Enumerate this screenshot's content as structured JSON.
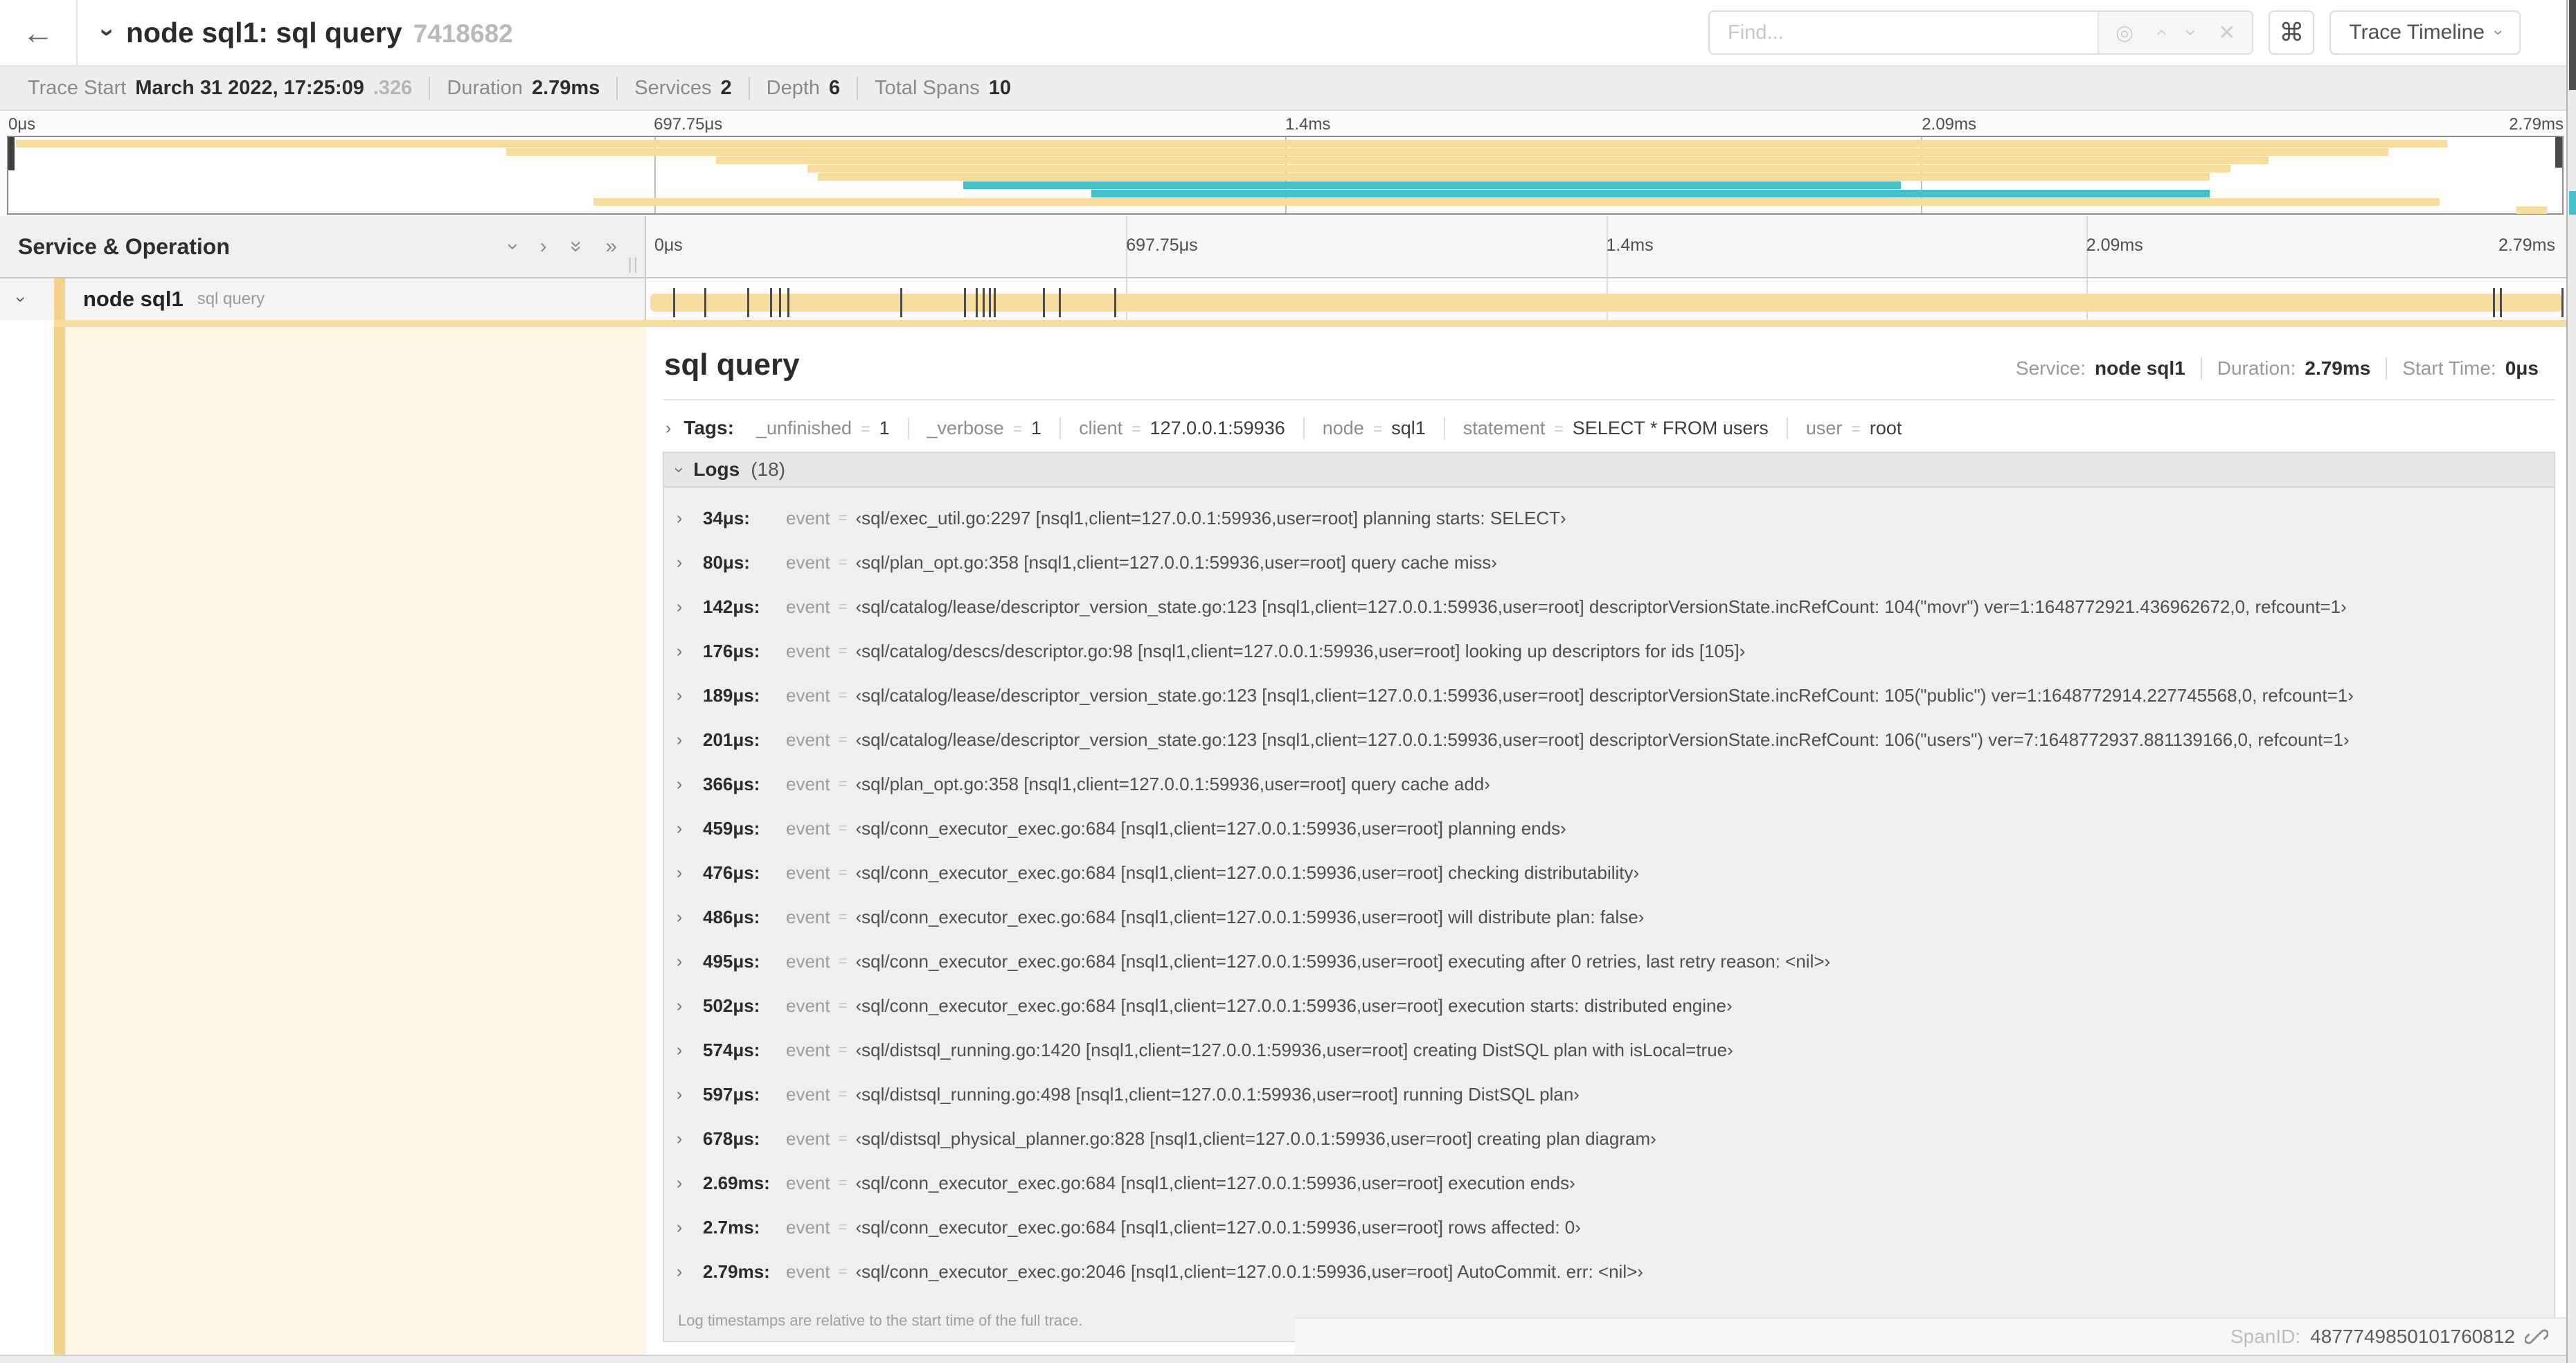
{
  "colors": {
    "tan": "#F7DCA0",
    "stripe": "#F5D28C",
    "cream": "#FDF6E7",
    "teal": "#45C2C9"
  },
  "header": {
    "back_icon": "←",
    "collapse_icon": "›",
    "title": "node sql1: sql query",
    "trace_id": "7418682",
    "find_placeholder": "Find...",
    "find_icons": {
      "locate": "◎",
      "prev": "›",
      "next": "›",
      "clear": "✕"
    },
    "shortcut_label": "⌘",
    "view_button_label": "Trace Timeline",
    "view_button_chev": "›"
  },
  "trace_info": {
    "items": [
      {
        "label": "Trace Start",
        "value": "March 31 2022, 17:25:09",
        "suffix": ".326"
      },
      {
        "label": "Duration",
        "value": "2.79ms",
        "suffix": ""
      },
      {
        "label": "Services",
        "value": "2",
        "suffix": ""
      },
      {
        "label": "Depth",
        "value": "6",
        "suffix": ""
      },
      {
        "label": "Total Spans",
        "value": "10",
        "suffix": ""
      }
    ]
  },
  "timeline": {
    "ruler_labels": [
      "0μs",
      "697.75μs",
      "1.4ms",
      "2.09ms",
      "2.79ms"
    ],
    "total_us": 2790,
    "tick_times_us": [
      34,
      80,
      142,
      176,
      189,
      201,
      366,
      459,
      476,
      486,
      495,
      502,
      574,
      597,
      678,
      2690,
      2700,
      2790
    ]
  },
  "minimap": {
    "bars": [
      {
        "color": "tan",
        "x": 0.003,
        "w": 0.952,
        "row": 0
      },
      {
        "color": "tan",
        "x": 0.195,
        "w": 0.737,
        "row": 1
      },
      {
        "color": "tan",
        "x": 0.277,
        "w": 0.608,
        "row": 2
      },
      {
        "color": "tan",
        "x": 0.313,
        "w": 0.557,
        "row": 3
      },
      {
        "color": "tan",
        "x": 0.317,
        "w": 0.545,
        "row": 4
      },
      {
        "color": "teal",
        "x": 0.374,
        "w": 0.367,
        "row": 5
      },
      {
        "color": "teal",
        "x": 0.424,
        "w": 0.438,
        "row": 6
      },
      {
        "color": "tan",
        "x": 0.229,
        "w": 0.723,
        "row": 7
      },
      {
        "color": "tan",
        "x": 0.982,
        "w": 0.012,
        "row": 8
      }
    ]
  },
  "span_list": {
    "header": "Service & Operation",
    "icons": {
      "collapse_one": "›",
      "expand_one": "›",
      "collapse_all": "»",
      "expand_all": "»"
    },
    "grip": "||",
    "row": {
      "chevron": "›",
      "service": "node sql1",
      "operation": "sql query"
    }
  },
  "detail": {
    "title": "sql query",
    "meta": {
      "service_label": "Service:",
      "service": "node sql1",
      "duration_label": "Duration:",
      "duration": "2.79ms",
      "start_label": "Start Time:",
      "start": "0μs"
    },
    "eq": "=",
    "tags_label": "Tags:",
    "tags": [
      {
        "key": "_unfinished",
        "value": "1"
      },
      {
        "key": "_verbose",
        "value": "1"
      },
      {
        "key": "client",
        "value": "127.0.0.1:59936"
      },
      {
        "key": "node",
        "value": "sql1"
      },
      {
        "key": "statement",
        "value": "SELECT * FROM users"
      },
      {
        "key": "user",
        "value": "root"
      }
    ],
    "logs": {
      "label": "Logs",
      "count": "(18)",
      "field": "event",
      "rows": [
        {
          "t": "34μs:",
          "value": "‹sql/exec_util.go:2297 [nsql1,client=127.0.0.1:59936,user=root] planning starts: SELECT›"
        },
        {
          "t": "80μs:",
          "value": "‹sql/plan_opt.go:358 [nsql1,client=127.0.0.1:59936,user=root] query cache miss›"
        },
        {
          "t": "142μs:",
          "value": "‹sql/catalog/lease/descriptor_version_state.go:123 [nsql1,client=127.0.0.1:59936,user=root] descriptorVersionState.incRefCount: 104(\"movr\") ver=1:1648772921.436962672,0, refcount=1›"
        },
        {
          "t": "176μs:",
          "value": "‹sql/catalog/descs/descriptor.go:98 [nsql1,client=127.0.0.1:59936,user=root] looking up descriptors for ids [105]›"
        },
        {
          "t": "189μs:",
          "value": "‹sql/catalog/lease/descriptor_version_state.go:123 [nsql1,client=127.0.0.1:59936,user=root] descriptorVersionState.incRefCount: 105(\"public\") ver=1:1648772914.227745568,0, refcount=1›"
        },
        {
          "t": "201μs:",
          "value": "‹sql/catalog/lease/descriptor_version_state.go:123 [nsql1,client=127.0.0.1:59936,user=root] descriptorVersionState.incRefCount: 106(\"users\") ver=7:1648772937.881139166,0, refcount=1›"
        },
        {
          "t": "366μs:",
          "value": "‹sql/plan_opt.go:358 [nsql1,client=127.0.0.1:59936,user=root] query cache add›"
        },
        {
          "t": "459μs:",
          "value": "‹sql/conn_executor_exec.go:684 [nsql1,client=127.0.0.1:59936,user=root] planning ends›"
        },
        {
          "t": "476μs:",
          "value": "‹sql/conn_executor_exec.go:684 [nsql1,client=127.0.0.1:59936,user=root] checking distributability›"
        },
        {
          "t": "486μs:",
          "value": "‹sql/conn_executor_exec.go:684 [nsql1,client=127.0.0.1:59936,user=root] will distribute plan: false›"
        },
        {
          "t": "495μs:",
          "value": "‹sql/conn_executor_exec.go:684 [nsql1,client=127.0.0.1:59936,user=root] executing after 0 retries, last retry reason: <nil>›"
        },
        {
          "t": "502μs:",
          "value": "‹sql/conn_executor_exec.go:684 [nsql1,client=127.0.0.1:59936,user=root] execution starts: distributed engine›"
        },
        {
          "t": "574μs:",
          "value": "‹sql/distsql_running.go:1420 [nsql1,client=127.0.0.1:59936,user=root] creating DistSQL plan with isLocal=true›"
        },
        {
          "t": "597μs:",
          "value": "‹sql/distsql_running.go:498 [nsql1,client=127.0.0.1:59936,user=root] running DistSQL plan›"
        },
        {
          "t": "678μs:",
          "value": "‹sql/distsql_physical_planner.go:828 [nsql1,client=127.0.0.1:59936,user=root] creating plan diagram›"
        },
        {
          "t": "2.69ms:",
          "value": "‹sql/conn_executor_exec.go:684 [nsql1,client=127.0.0.1:59936,user=root] execution ends›"
        },
        {
          "t": "2.7ms:",
          "value": "‹sql/conn_executor_exec.go:684 [nsql1,client=127.0.0.1:59936,user=root] rows affected: 0›"
        },
        {
          "t": "2.79ms:",
          "value": "‹sql/conn_executor_exec.go:2046 [nsql1,client=127.0.0.1:59936,user=root] AutoCommit. err: <nil>›"
        }
      ]
    },
    "footer": "Log timestamps are relative to the start time of the full trace.",
    "span_id_label": "SpanID:",
    "span_id": "4877749850101760812"
  }
}
